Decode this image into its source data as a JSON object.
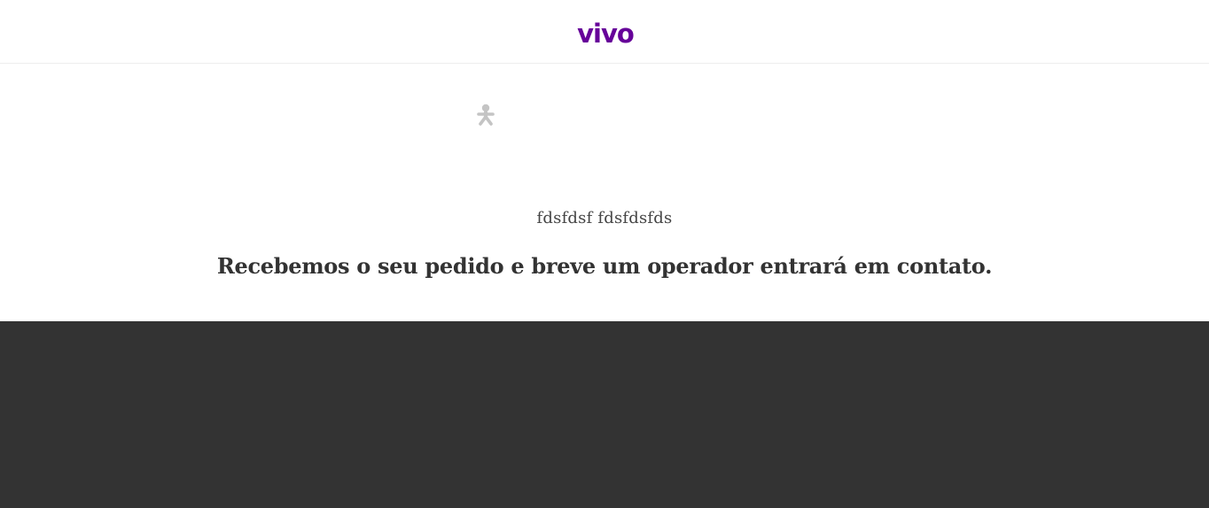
{
  "header": {
    "logo_text": "vivo"
  },
  "main": {
    "icon": "person-icon",
    "name": "fdsfdsf fdsfdsfds",
    "message": "Recebemos o seu pedido e breve um operador entrará em contato."
  },
  "colors": {
    "brand": "#660099",
    "icon": "#c4c4c4",
    "footer": "#333333"
  }
}
